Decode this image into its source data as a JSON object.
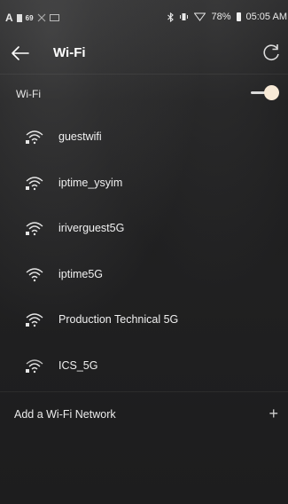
{
  "status_bar": {
    "left_letter": "A",
    "left_badge": "69",
    "battery": "78%",
    "time": "05:05 AM"
  },
  "header": {
    "title": "Wi-Fi",
    "back_icon": "back-arrow-icon",
    "refresh_icon": "refresh-icon"
  },
  "wifi_toggle": {
    "label": "Wi-Fi",
    "state": "on"
  },
  "networks": [
    {
      "name": "guestwifi",
      "secured": true
    },
    {
      "name": "iptime_ysyim",
      "secured": true
    },
    {
      "name": "iriverguest5G",
      "secured": true
    },
    {
      "name": "iptime5G",
      "secured": false
    },
    {
      "name": "Production Technical 5G",
      "secured": true
    },
    {
      "name": "ICS_5G",
      "secured": true
    }
  ],
  "add_network": {
    "label": "Add a Wi-Fi Network",
    "icon": "plus-icon"
  },
  "colors": {
    "background": "#1d1d1e",
    "text": "#f0f0f0",
    "toggle_knob": "#f7e9d6"
  }
}
